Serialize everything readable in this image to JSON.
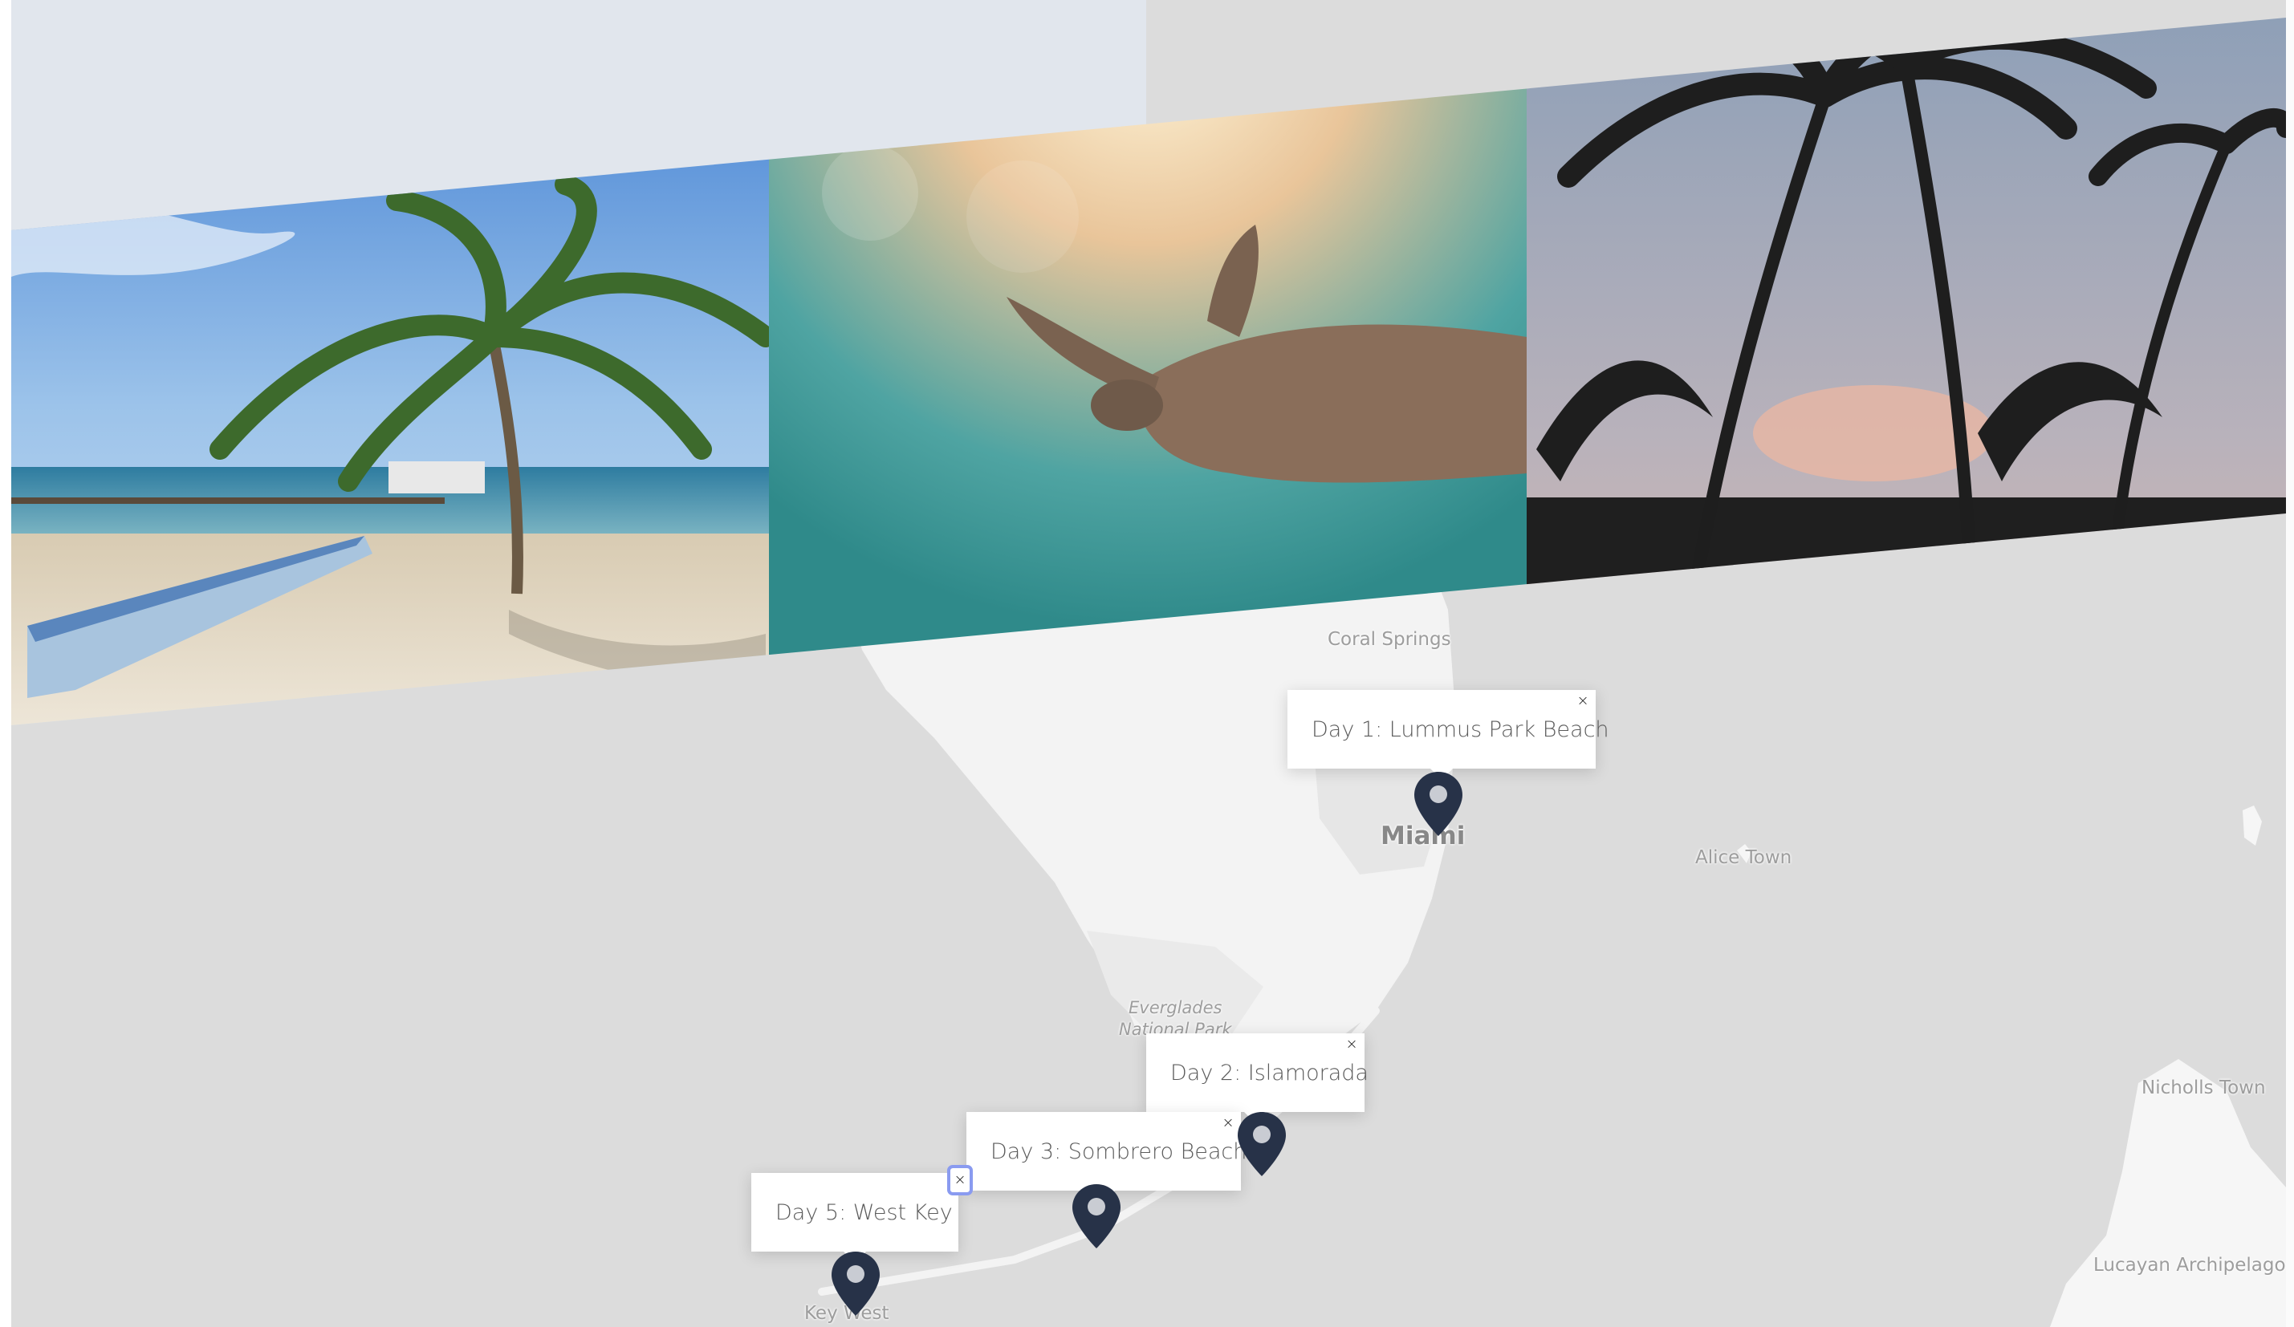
{
  "map": {
    "labels": {
      "coral_springs": "Coral Springs",
      "miami": "Miami",
      "alice_town": "Alice Town",
      "everglades_line1": "Everglades",
      "everglades_line2": "National Park",
      "nicholls_town": "Nicholls Town",
      "lucayan": "Lucayan Archipelago",
      "key_west": "Key West"
    },
    "popups": [
      {
        "label": "Day 1: Lummus Park Beach",
        "close": "×"
      },
      {
        "label": "Day 2: Islamorada",
        "close": "×"
      },
      {
        "label": "Day 3: Sombrero Beach",
        "close": "×"
      },
      {
        "label": "Day 5: West Key",
        "close": "×"
      }
    ]
  },
  "photos": [
    {
      "subject": "beach-palm-canoe"
    },
    {
      "subject": "sea-turtle-underwater"
    },
    {
      "subject": "palm-silhouettes-sunset"
    }
  ],
  "colors": {
    "marker": "#273248",
    "water": "#dcdcdc",
    "land": "#f4f4f4",
    "band": "#e1e6ed"
  }
}
